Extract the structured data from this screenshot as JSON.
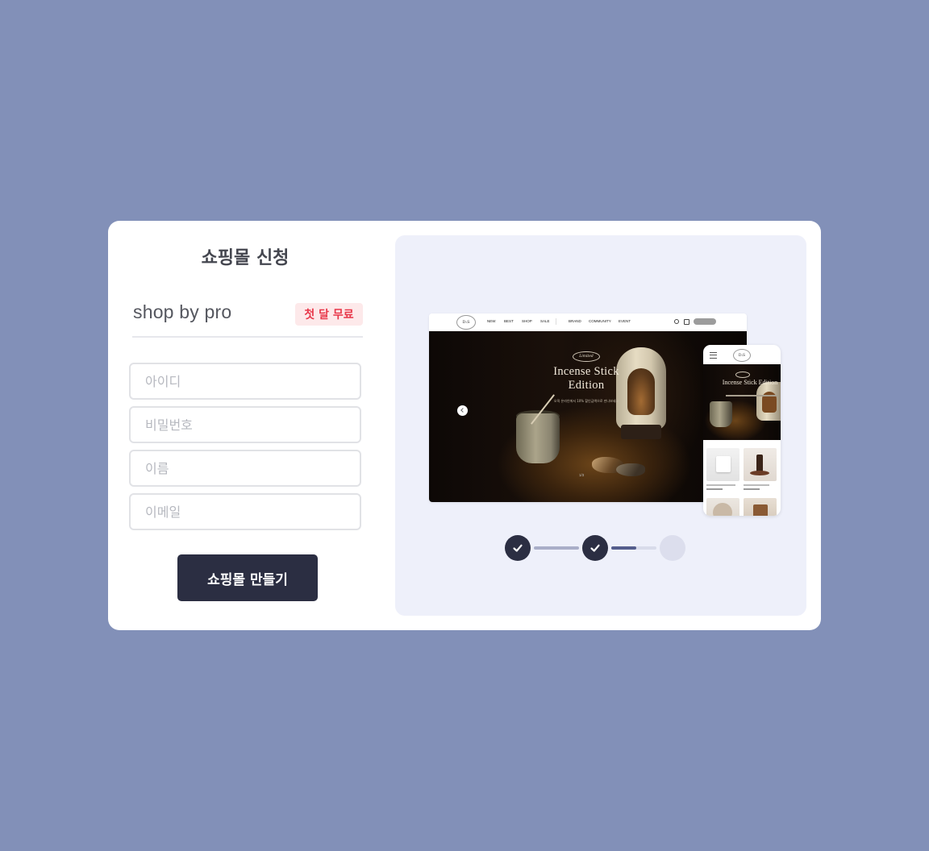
{
  "form": {
    "title": "쇼핑몰 신청",
    "plan_name": "shop by pro",
    "plan_badge": "첫 달 무료",
    "fields": {
      "id": {
        "placeholder": "아이디",
        "value": ""
      },
      "password": {
        "placeholder": "비밀번호",
        "value": ""
      },
      "name": {
        "placeholder": "이름",
        "value": ""
      },
      "email": {
        "placeholder": "이메일",
        "value": ""
      }
    },
    "submit_label": "쇼핑몰 만들기"
  },
  "preview": {
    "desktop": {
      "logo": "D:S",
      "nav": [
        "NEW",
        "BEST",
        "SHOP",
        "SALE",
        "BRAND",
        "COMMUNITY",
        "EVENT"
      ],
      "hero_badge": "Limited",
      "hero_title": "Incense Stick Edition",
      "hero_subtitle": "오직 온라인에서 10% 할인금액으로 만나보세요",
      "pagination": "1/3"
    },
    "mobile": {
      "logo": "D:S",
      "hero_title": "Incense Stick Edition"
    }
  },
  "stepper": {
    "steps": [
      {
        "status": "complete",
        "icon": "check-icon"
      },
      {
        "status": "complete",
        "icon": "check-icon"
      },
      {
        "status": "pending"
      }
    ],
    "progress_in_current_segment": 0.55
  },
  "colors": {
    "background": "#8290b8",
    "panel": "#eef0fa",
    "primary": "#2b2e42",
    "badge_bg": "#fde9ea",
    "badge_text": "#e8384a"
  }
}
